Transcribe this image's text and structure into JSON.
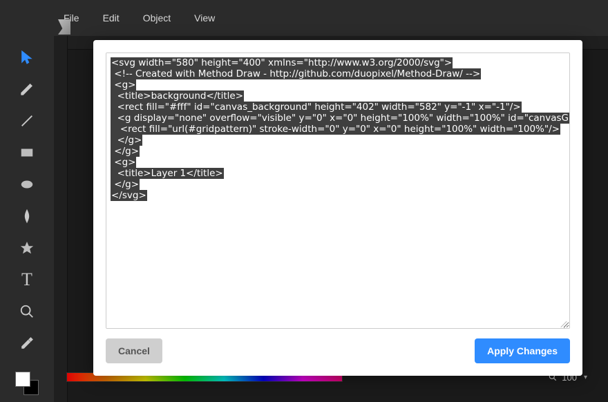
{
  "menu": {
    "items": [
      "File",
      "Edit",
      "Object",
      "View"
    ]
  },
  "tools": [
    {
      "id": "select",
      "name": "select-tool-icon"
    },
    {
      "id": "pencil",
      "name": "pencil-tool-icon"
    },
    {
      "id": "line",
      "name": "line-tool-icon"
    },
    {
      "id": "rect",
      "name": "rect-tool-icon"
    },
    {
      "id": "ellipse",
      "name": "ellipse-tool-icon"
    },
    {
      "id": "path",
      "name": "path-tool-icon"
    },
    {
      "id": "star",
      "name": "star-tool-icon"
    },
    {
      "id": "text",
      "name": "text-tool-icon"
    },
    {
      "id": "zoom",
      "name": "zoom-tool-icon"
    },
    {
      "id": "eyedropper",
      "name": "eyedropper-tool-icon"
    }
  ],
  "zoom": {
    "value": "100"
  },
  "dialog": {
    "code_lines": [
      "<svg width=\"580\" height=\"400\" xmlns=\"http://www.w3.org/2000/svg\">",
      " <!-- Created with Method Draw - http://github.com/duopixel/Method-Draw/ -->",
      " <g>",
      "  <title>background</title>",
      "  <rect fill=\"#fff\" id=\"canvas_background\" height=\"402\" width=\"582\" y=\"-1\" x=\"-1\"/>",
      "  <g display=\"none\" overflow=\"visible\" y=\"0\" x=\"0\" height=\"100%\" width=\"100%\" id=\"canvasGrid\">",
      "   <rect fill=\"url(#gridpattern)\" stroke-width=\"0\" y=\"0\" x=\"0\" height=\"100%\" width=\"100%\"/>",
      "  </g>",
      " </g>",
      " <g>",
      "  <title>Layer 1</title>",
      " </g>",
      "</svg>"
    ],
    "cancel_label": "Cancel",
    "apply_label": "Apply Changes"
  }
}
